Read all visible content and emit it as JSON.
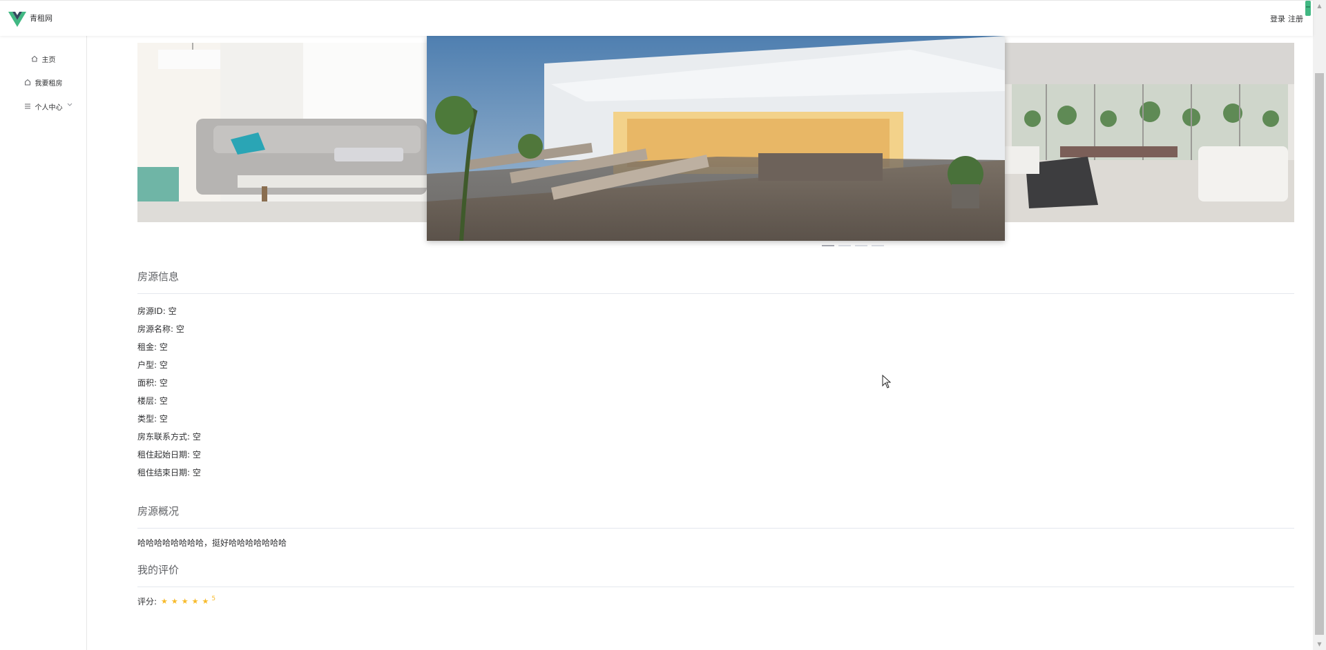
{
  "header": {
    "site_name": "青租网",
    "login": "登录",
    "register": "注册"
  },
  "sidebar": {
    "items": [
      {
        "label": "主页",
        "icon": "home-icon"
      },
      {
        "label": "我要租房",
        "icon": "house-icon"
      },
      {
        "label": "个人中心",
        "icon": "menu-icon",
        "has_submenu": true
      }
    ]
  },
  "carousel": {
    "slides": [
      "living-room",
      "patio",
      "lounge"
    ],
    "indicator_count": 4,
    "active_index": 0
  },
  "house_info": {
    "title": "房源信息",
    "fields": [
      {
        "label": "房源ID:",
        "value": "空"
      },
      {
        "label": "房源名称:",
        "value": "空"
      },
      {
        "label": "租金:",
        "value": "空"
      },
      {
        "label": "户型:",
        "value": "空"
      },
      {
        "label": "面积:",
        "value": "空"
      },
      {
        "label": "楼层:",
        "value": "空"
      },
      {
        "label": "类型:",
        "value": "空"
      },
      {
        "label": "房东联系方式:",
        "value": "空"
      },
      {
        "label": "租住起始日期:",
        "value": "空"
      },
      {
        "label": "租住结束日期:",
        "value": "空"
      }
    ]
  },
  "overview": {
    "title": "房源概况",
    "text": "哈哈哈哈哈哈哈哈，挺好哈哈哈哈哈哈哈"
  },
  "review": {
    "title": "我的评价",
    "label": "评分:",
    "stars": 5,
    "score": "5"
  },
  "colors": {
    "accent_star": "#f7ba2a",
    "logo_green": "#41b883",
    "logo_dark": "#34495e"
  }
}
